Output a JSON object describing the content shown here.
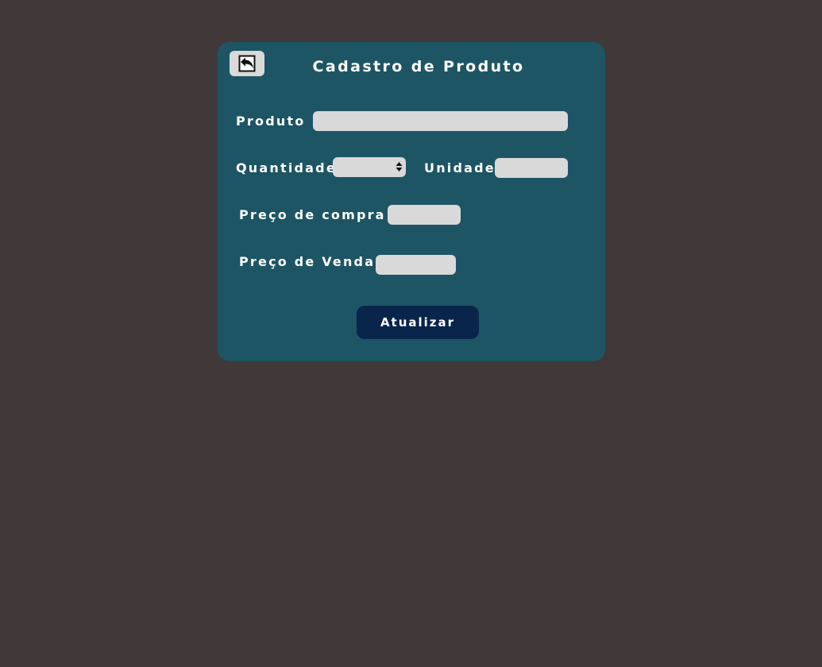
{
  "form": {
    "title": "Cadastro de Produto",
    "back_icon": "back-arrow-icon",
    "produto": {
      "label": "Produto",
      "value": ""
    },
    "quantidade": {
      "label": "Quantidade",
      "value": ""
    },
    "unidade": {
      "label": "Unidade",
      "value": ""
    },
    "preco_compra": {
      "label": "Preço de compra",
      "value": ""
    },
    "preco_venda": {
      "label": "Preço de Venda",
      "value": ""
    },
    "submit_label": "Atualizar"
  },
  "colors": {
    "page_background": "#413839",
    "card_background": "#1e5564",
    "field_background": "#d9d9d9",
    "button_background": "#0a254c",
    "text": "#ffffff"
  }
}
